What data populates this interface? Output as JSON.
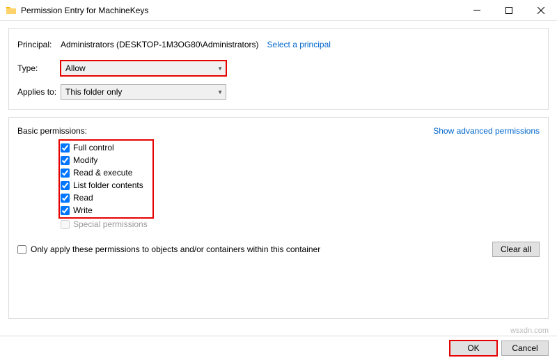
{
  "titlebar": {
    "title": "Permission Entry for MachineKeys"
  },
  "principal": {
    "label": "Principal:",
    "value": "Administrators (DESKTOP-1M3OG80\\Administrators)",
    "select_link": "Select a principal"
  },
  "type": {
    "label": "Type:",
    "value": "Allow"
  },
  "applies": {
    "label": "Applies to:",
    "value": "This folder only"
  },
  "permissions": {
    "header": "Basic permissions:",
    "advanced_link": "Show advanced permissions",
    "items": [
      {
        "label": "Full control",
        "checked": true
      },
      {
        "label": "Modify",
        "checked": true
      },
      {
        "label": "Read & execute",
        "checked": true
      },
      {
        "label": "List folder contents",
        "checked": true
      },
      {
        "label": "Read",
        "checked": true
      },
      {
        "label": "Write",
        "checked": true
      }
    ],
    "special": "Special permissions"
  },
  "only_apply": {
    "label": "Only apply these permissions to objects and/or containers within this container",
    "checked": false
  },
  "buttons": {
    "clear_all": "Clear all",
    "ok": "OK",
    "cancel": "Cancel"
  },
  "watermark": "wsxdn.com"
}
